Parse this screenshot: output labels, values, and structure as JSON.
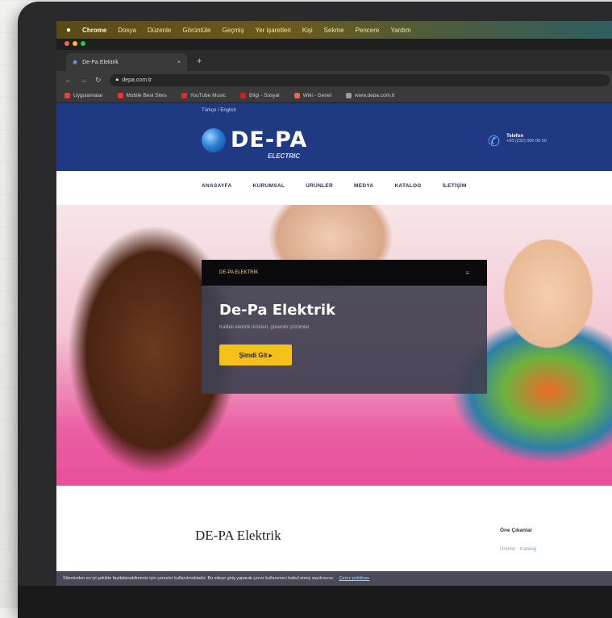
{
  "menubar": {
    "app": "Chrome",
    "items": [
      "Dosya",
      "Düzenle",
      "Görüntüle",
      "Geçmiş",
      "Yer işaretleri",
      "Kişi",
      "Sekme",
      "Pencere",
      "Yardım"
    ]
  },
  "browser": {
    "tab_title": "De-Pa Elektrik",
    "tab_close": "×",
    "new_tab": "+",
    "url": "depa.com.tr",
    "bookmarks": [
      "Uygulamalar",
      "Mobile Best Sites",
      "YouTube Music",
      "Bilgi - Sosyal",
      "Wiki - Genel",
      "www.depa.com.tr"
    ]
  },
  "site": {
    "lang": "Türkçe / English",
    "logo_name": "DE-PA",
    "logo_sub": "ELECTRIC",
    "contact_title": "Telefon",
    "contact_text": "+90 (232) 000 00 00",
    "nav": [
      "ANASAYFA",
      "KURUMSAL",
      "ÜRÜNLER",
      "MEDYA",
      "KATALOG",
      "İLETİŞİM"
    ],
    "slider_head": "DE-PA ELEKTRİK",
    "slider_menu": "≡",
    "hero_title": "De-Pa Elektrik",
    "hero_desc": "Kaliteli elektrik ürünleri, güvenilir çözümler",
    "cta": "Şimdi Git ▸",
    "content_title": "DE-PA Elektrik",
    "side_title": "Öne Çıkanlar",
    "side_text": "Ürünler · Katalog",
    "cookie": "Sitemizden en iyi şekilde faydalanabilmeniz için çerezler kullanılmaktadır. Bu siteye giriş yaparak çerez kullanımını kabul etmiş sayılırsınız.",
    "cookie_link": "Çerez politikası"
  },
  "colors": {
    "brand_blue": "#1f3a82",
    "cta_yellow": "#f3c11a"
  }
}
